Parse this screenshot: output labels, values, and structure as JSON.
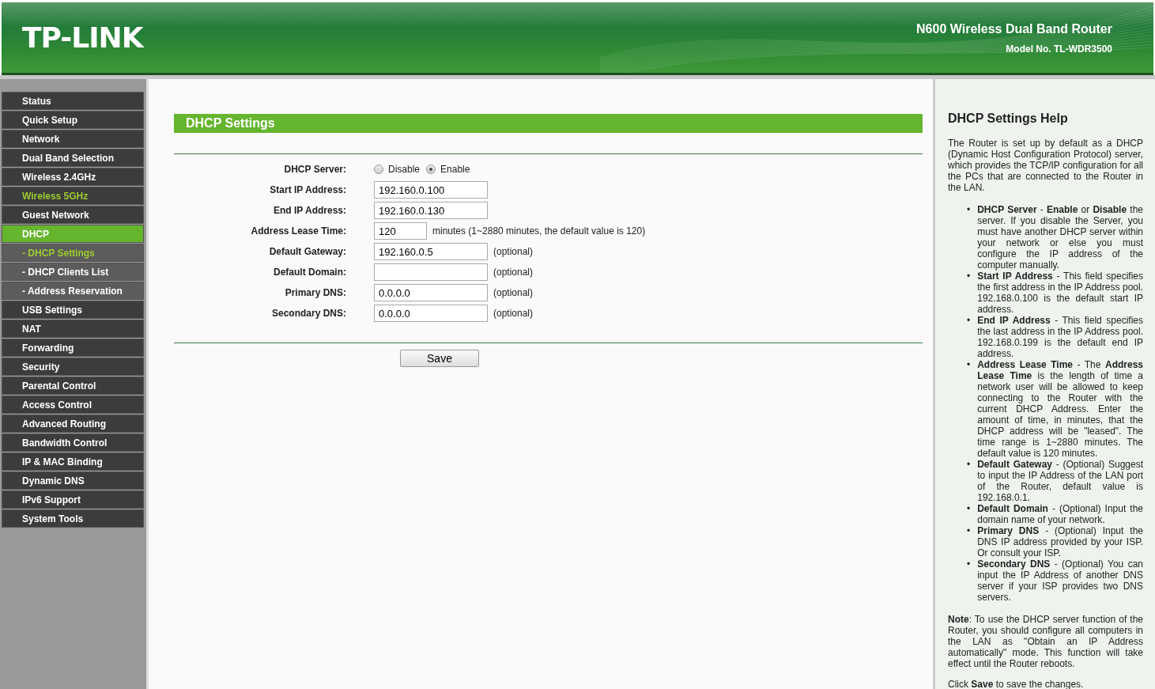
{
  "header": {
    "brand": "TP-LINK",
    "product": "N600 Wireless Dual Band Router",
    "model": "Model No. TL-WDR3500"
  },
  "sidebar": {
    "items": [
      {
        "label": "Status",
        "kind": "main",
        "selected": false,
        "hovered": false
      },
      {
        "label": "Quick Setup",
        "kind": "main",
        "selected": false,
        "hovered": false
      },
      {
        "label": "Network",
        "kind": "main",
        "selected": false,
        "hovered": false
      },
      {
        "label": "Dual Band Selection",
        "kind": "main",
        "selected": false,
        "hovered": false
      },
      {
        "label": "Wireless 2.4GHz",
        "kind": "main",
        "selected": false,
        "hovered": false
      },
      {
        "label": "Wireless 5GHz",
        "kind": "main",
        "selected": false,
        "hovered": true
      },
      {
        "label": "Guest Network",
        "kind": "main",
        "selected": false,
        "hovered": false
      },
      {
        "label": "DHCP",
        "kind": "main",
        "selected": true,
        "hovered": false
      },
      {
        "label": "- DHCP Settings",
        "kind": "sub",
        "selected": true,
        "hovered": false
      },
      {
        "label": "- DHCP Clients List",
        "kind": "sub",
        "selected": false,
        "hovered": false
      },
      {
        "label": "- Address Reservation",
        "kind": "sub",
        "selected": false,
        "hovered": false
      },
      {
        "label": "USB Settings",
        "kind": "main",
        "selected": false,
        "hovered": false
      },
      {
        "label": "NAT",
        "kind": "main",
        "selected": false,
        "hovered": false
      },
      {
        "label": "Forwarding",
        "kind": "main",
        "selected": false,
        "hovered": false
      },
      {
        "label": "Security",
        "kind": "main",
        "selected": false,
        "hovered": false
      },
      {
        "label": "Parental Control",
        "kind": "main",
        "selected": false,
        "hovered": false
      },
      {
        "label": "Access Control",
        "kind": "main",
        "selected": false,
        "hovered": false
      },
      {
        "label": "Advanced Routing",
        "kind": "main",
        "selected": false,
        "hovered": false
      },
      {
        "label": "Bandwidth Control",
        "kind": "main",
        "selected": false,
        "hovered": false
      },
      {
        "label": "IP & MAC Binding",
        "kind": "main",
        "selected": false,
        "hovered": false
      },
      {
        "label": "Dynamic DNS",
        "kind": "main",
        "selected": false,
        "hovered": false
      },
      {
        "label": "IPv6 Support",
        "kind": "main",
        "selected": false,
        "hovered": false
      },
      {
        "label": "System Tools",
        "kind": "main",
        "selected": false,
        "hovered": false
      }
    ]
  },
  "form": {
    "title": "DHCP Settings",
    "fields": [
      {
        "kind": "radio",
        "label": "DHCP Server:",
        "options": [
          {
            "label": "Disable",
            "selected": false
          },
          {
            "label": "Enable",
            "selected": true
          }
        ]
      },
      {
        "kind": "text",
        "label": "Start IP Address:",
        "value": "192.160.0.100"
      },
      {
        "kind": "text",
        "label": "End IP Address:",
        "value": "192.160.0.130"
      },
      {
        "kind": "short",
        "label": "Address Lease Time:",
        "value": "120",
        "note": "minutes (1~2880 minutes, the default value is 120)"
      },
      {
        "kind": "text",
        "label": "Default Gateway:",
        "value": "192.160.0.5",
        "note": "(optional)"
      },
      {
        "kind": "text",
        "label": "Default Domain:",
        "note": "(optional)"
      },
      {
        "kind": "text",
        "label": "Primary DNS:",
        "value": "0.0.0.0",
        "note": "(optional)"
      },
      {
        "kind": "text",
        "label": "Secondary DNS:",
        "value": "0.0.0.0",
        "note": "(optional)"
      }
    ],
    "save_button": "Save"
  },
  "help": {
    "title": "DHCP Settings Help",
    "intro": "The Router is set up by default as a DHCP (Dynamic Host Configuration Protocol) server, which provides the TCP/IP configuration for all the PCs that are connected to the Router in the LAN.",
    "bullet": "•",
    "items": [
      "**DHCP Server** - **Enable** or **Disable** the server. If you disable the Server, you must have another DHCP server within your network or else you must configure the IP address of the computer manually.",
      "**Start IP Address** - This field specifies the first address in the IP Address pool. 192.168.0.100 is the default start IP address.",
      "**End IP Address** - This field specifies the last address in the IP Address pool. 192.168.0.199 is the default end IP address.",
      "**Address Lease Time** - The **Address Lease Time** is the length of time a network user will be allowed to keep connecting to the Router with the current DHCP Address. Enter the amount of time, in minutes, that the DHCP address will be \"leased\". The time range is 1~2880 minutes. The default value is 120 minutes.",
      "**Default Gateway** - (Optional) Suggest to input the IP Address of the LAN port of the Router, default value is 192.168.0.1.",
      "**Default Domain** - (Optional) Input the domain name of your network.",
      "**Primary DNS** - (Optional) Input the DNS IP address provided by your ISP. Or consult your ISP.",
      "**Secondary DNS** - (Optional) You can input the IP Address of another DNS server if your ISP provides two DNS servers."
    ],
    "note": "**Note**: To use the DHCP server function of the Router, you should configure all computers in the LAN as \"Obtain an IP Address automatically\" mode. This function will take effect until the Router reboots.",
    "footer": "Click **Save** to save the changes."
  }
}
